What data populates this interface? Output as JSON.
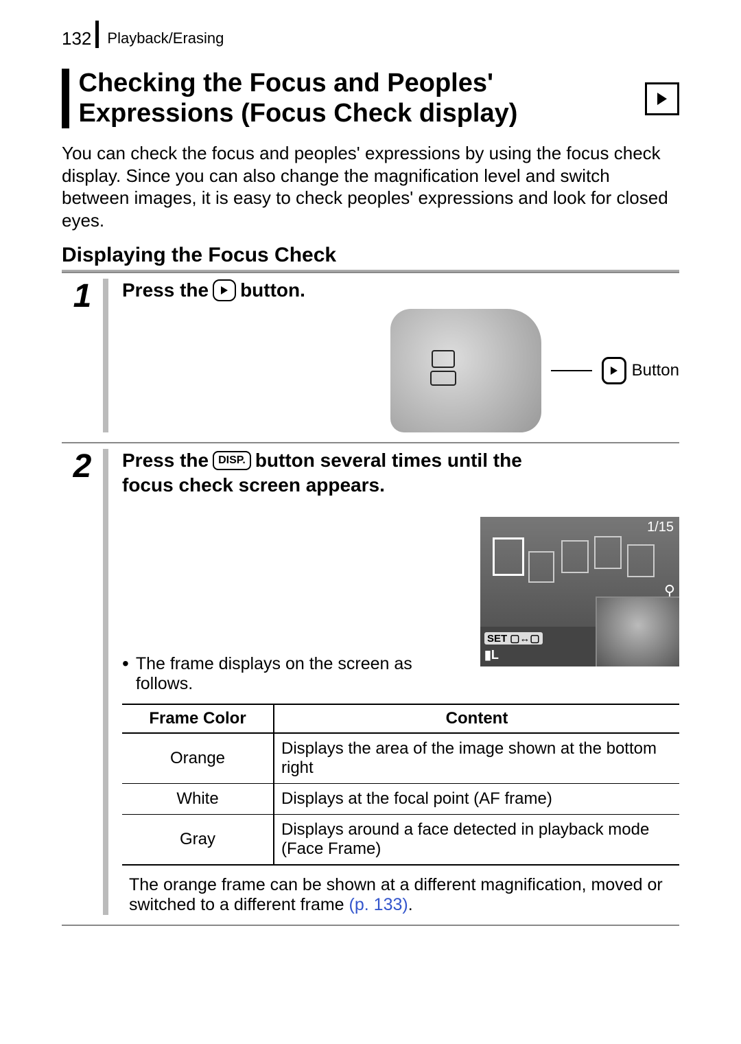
{
  "header": {
    "page_number": "132",
    "section": "Playback/Erasing"
  },
  "title": "Checking the Focus and Peoples' Expressions (Focus Check display)",
  "intro": "You can check the focus and peoples' expressions by using the focus check display. Since you can also change the magnification level and switch between images, it is easy to check peoples' expressions and look for closed eyes.",
  "subheading": "Displaying the Focus Check",
  "steps": {
    "s1": {
      "num": "1",
      "title_prefix": "Press the",
      "title_suffix": "button.",
      "button_label": "Button"
    },
    "s2": {
      "num": "2",
      "title_prefix": "Press the",
      "disp_label": "DISP.",
      "title_mid": "button several times until the",
      "title_line2": "focus check screen appears.",
      "screen": {
        "counter": "1/15",
        "set_label": "SET",
        "magnify_icon": "⚲",
        "quality": "▮L"
      },
      "bullet1": "The frame displays on the screen as follows.",
      "table": {
        "h1": "Frame Color",
        "h2": "Content",
        "rows": [
          {
            "c": "Orange",
            "d": "Displays the area of the image shown at the bottom right"
          },
          {
            "c": "White",
            "d": "Displays at the focal point (AF frame)"
          },
          {
            "c": "Gray",
            "d": "Displays around a face detected in playback mode (Face Frame)"
          }
        ]
      },
      "note_text": "The orange frame can be shown at a different magnification, moved or switched to a different frame ",
      "note_link": "(p. 133)",
      "note_tail": "."
    }
  }
}
